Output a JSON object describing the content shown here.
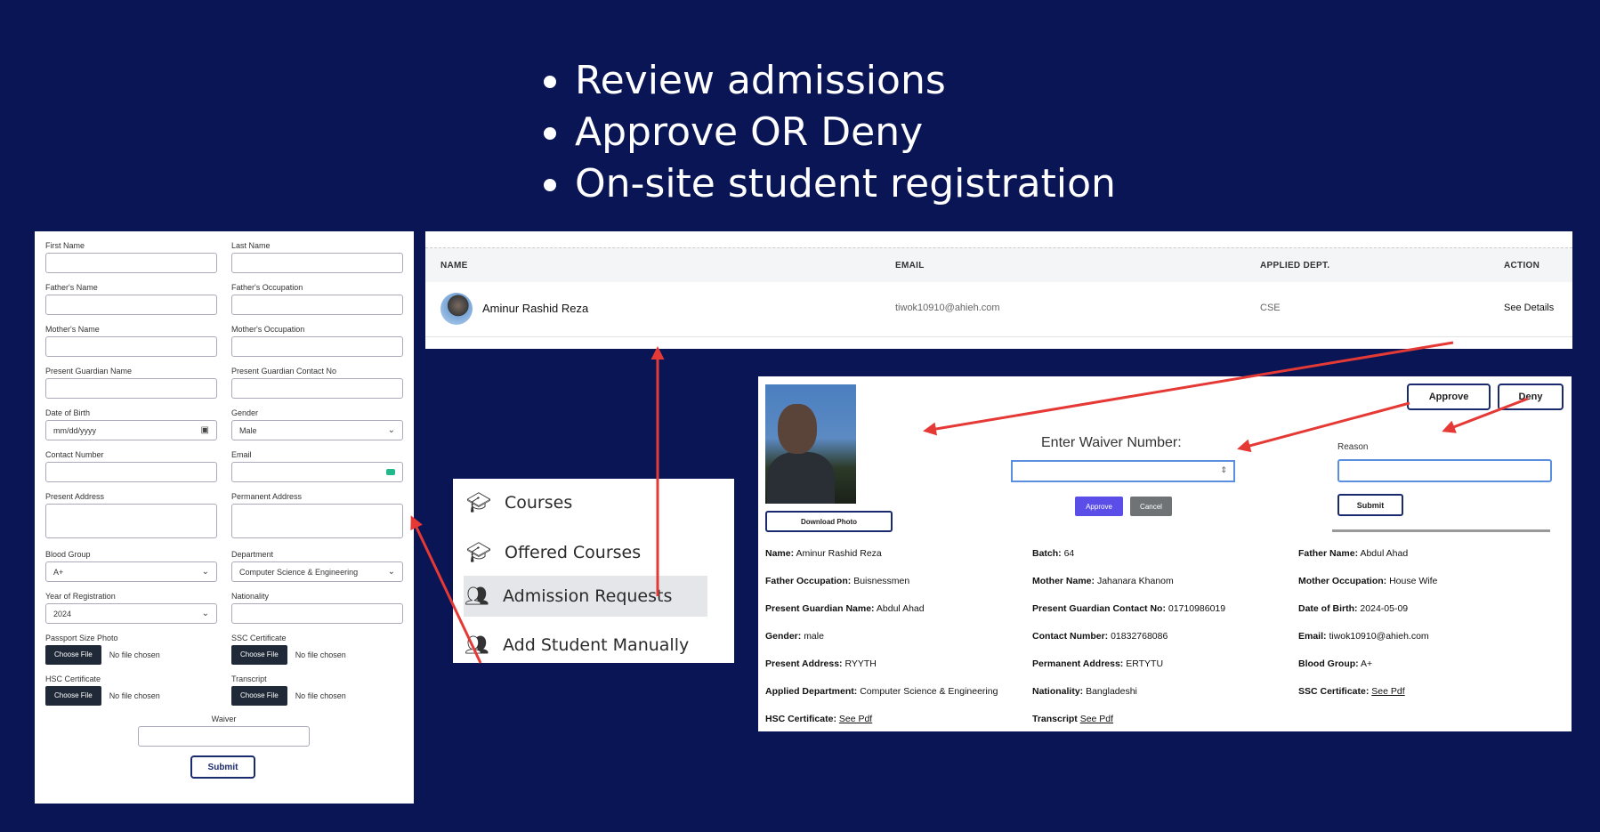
{
  "headline_bullets": [
    "Review admissions",
    "Approve OR Deny",
    "On-site student registration"
  ],
  "form": {
    "first_name": "First Name",
    "last_name": "Last Name",
    "fathers_name": "Father's Name",
    "fathers_occupation": "Father's Occupation",
    "mothers_name": "Mother's Name",
    "mothers_occupation": "Mother's Occupation",
    "guardian_name": "Present Guardian Name",
    "guardian_contact": "Present Guardian Contact No",
    "dob_label": "Date of Birth",
    "dob_placeholder": "mm/dd/yyyy",
    "gender_label": "Gender",
    "gender_value": "Male",
    "contact_label": "Contact Number",
    "email_label": "Email",
    "present_address": "Present Address",
    "permanent_address": "Permanent Address",
    "blood_group_label": "Blood Group",
    "blood_group_value": "A+",
    "department_label": "Department",
    "department_value": "Computer Science & Engineering",
    "year_label": "Year of Registration",
    "year_value": "2024",
    "nationality_label": "Nationality",
    "photo_label": "Passport Size Photo",
    "ssc_label": "SSC Certificate",
    "hsc_label": "HSC Certificate",
    "transcript_label": "Transcript",
    "choose_file": "Choose File",
    "no_file": "No file chosen",
    "waiver_label": "Waiver",
    "submit": "Submit"
  },
  "requests": {
    "headers": {
      "name": "NAME",
      "email": "EMAIL",
      "dept": "APPLIED DEPT.",
      "action": "ACTION"
    },
    "row": {
      "name": "Aminur Rashid Reza",
      "email": "tiwok10910@ahieh.com",
      "dept": "CSE",
      "action": "See Details"
    }
  },
  "sidebar": {
    "items": [
      {
        "label": "Courses",
        "icon": "graduation-cap-icon"
      },
      {
        "label": "Offered Courses",
        "icon": "graduation-cap-icon"
      },
      {
        "label": "Admission Requests",
        "icon": "users-icon"
      },
      {
        "label": "Add Student Manually",
        "icon": "users-icon"
      }
    ],
    "active_index": 2
  },
  "details": {
    "download_photo": "Download Photo",
    "waiver_title": "Enter Waiver Number:",
    "waiver_approve": "Approve",
    "waiver_cancel": "Cancel",
    "approve": "Approve",
    "deny": "Deny",
    "reason_label": "Reason",
    "reason_submit": "Submit",
    "see_pdf": "See Pdf",
    "fields": {
      "name": {
        "label": "Name:",
        "value": "Aminur Rashid Reza"
      },
      "batch": {
        "label": "Batch:",
        "value": "64"
      },
      "father_name": {
        "label": "Father Name:",
        "value": "Abdul Ahad"
      },
      "father_occupation": {
        "label": "Father Occupation:",
        "value": "Buisnessmen"
      },
      "mother_name": {
        "label": "Mother Name:",
        "value": "Jahanara Khanom"
      },
      "mother_occupation": {
        "label": "Mother Occupation:",
        "value": "House Wife"
      },
      "guardian_name": {
        "label": "Present Guardian Name:",
        "value": "Abdul Ahad"
      },
      "guardian_contact": {
        "label": "Present Guardian Contact No:",
        "value": "01710986019"
      },
      "dob": {
        "label": "Date of Birth:",
        "value": "2024-05-09"
      },
      "gender": {
        "label": "Gender:",
        "value": "male"
      },
      "contact": {
        "label": "Contact Number:",
        "value": "01832768086"
      },
      "email": {
        "label": "Email:",
        "value": "tiwok10910@ahieh.com"
      },
      "present_address": {
        "label": "Present Address:",
        "value": "RYYTH"
      },
      "permanent_address": {
        "label": "Permanent Address:",
        "value": "ERTYTU"
      },
      "blood_group": {
        "label": "Blood Group:",
        "value": "A+"
      },
      "applied_department": {
        "label": "Applied Department:",
        "value": "Computer Science & Engineering"
      },
      "nationality": {
        "label": "Nationality:",
        "value": "Bangladeshi"
      },
      "ssc": {
        "label": "SSC Certificate:"
      },
      "hsc": {
        "label": "HSC Certificate:"
      },
      "transcript": {
        "label": "Transcript"
      }
    }
  },
  "colors": {
    "background": "#0a1555",
    "arrow": "#e53935",
    "accent": "#5b4ee8"
  }
}
